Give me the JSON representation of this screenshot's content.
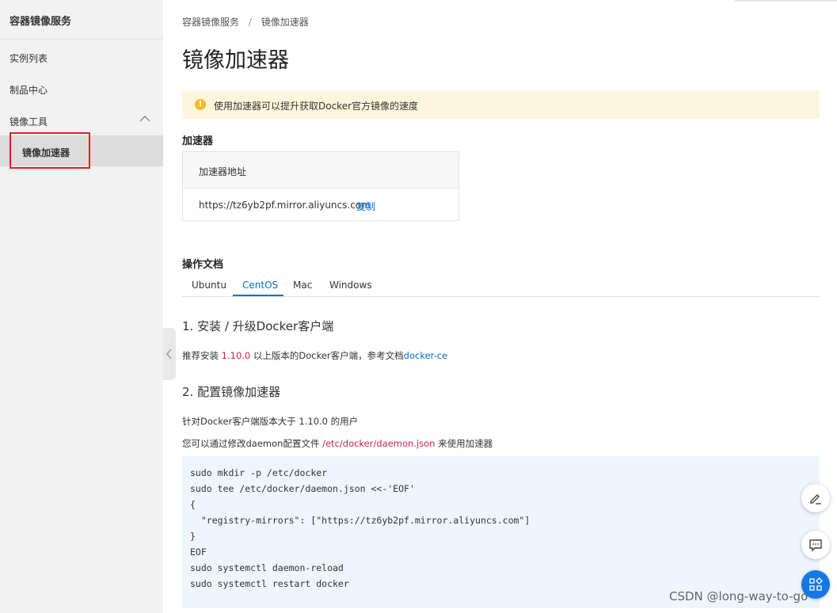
{
  "sidebar": {
    "title": "容器镜像服务",
    "items": [
      {
        "label": "实例列表"
      },
      {
        "label": "制品中心"
      },
      {
        "label": "镜像工具"
      },
      {
        "label": "镜像加速器"
      }
    ]
  },
  "breadcrumb": {
    "root": "容器镜像服务",
    "separator": "/",
    "current": "镜像加速器"
  },
  "page": {
    "title": "镜像加速器"
  },
  "notice": {
    "icon": "warning-icon",
    "text": "使用加速器可以提升获取Docker官方镜像的速度"
  },
  "accelerator": {
    "section_title": "加速器",
    "header": "加速器地址",
    "url": "https://tz6yb2pf.mirror.aliyuncs.com",
    "copy_label": "复制"
  },
  "docs": {
    "section_title": "操作文档",
    "tabs": [
      {
        "label": "Ubuntu"
      },
      {
        "label": "CentOS"
      },
      {
        "label": "Mac"
      },
      {
        "label": "Windows"
      }
    ],
    "active_tab": "CentOS",
    "step1_title": "1. 安装 / 升级Docker客户端",
    "step1_prefix": "推荐安装 ",
    "step1_version": "1.10.0",
    "step1_middle": " 以上版本的Docker客户端，参考文档",
    "step1_link": "docker-ce",
    "step2_title": "2. 配置镜像加速器",
    "step2_line1": "针对Docker客户端版本大于 1.10.0 的用户",
    "step2_line2_prefix": "您可以通过修改daemon配置文件 ",
    "step2_path": "/etc/docker/daemon.json",
    "step2_line2_suffix": " 来使用加速器",
    "code": "sudo mkdir -p /etc/docker\nsudo tee /etc/docker/daemon.json <<-'EOF'\n{\n  \"registry-mirrors\": [\"https://tz6yb2pf.mirror.aliyuncs.com\"]\n}\nEOF\nsudo systemctl daemon-reload\nsudo systemctl restart docker"
  },
  "floating": {
    "buttons": [
      {
        "icon": "edit-icon"
      },
      {
        "icon": "chat-icon"
      },
      {
        "icon": "apps-icon"
      }
    ]
  },
  "watermark": "CSDN @long-way-to-go",
  "colors": {
    "accent": "#ff6a00",
    "link": "#0070cc",
    "highlight_red": "#c7254e",
    "notice_bg": "#fdf6dd",
    "code_bg": "#eef5fd"
  }
}
